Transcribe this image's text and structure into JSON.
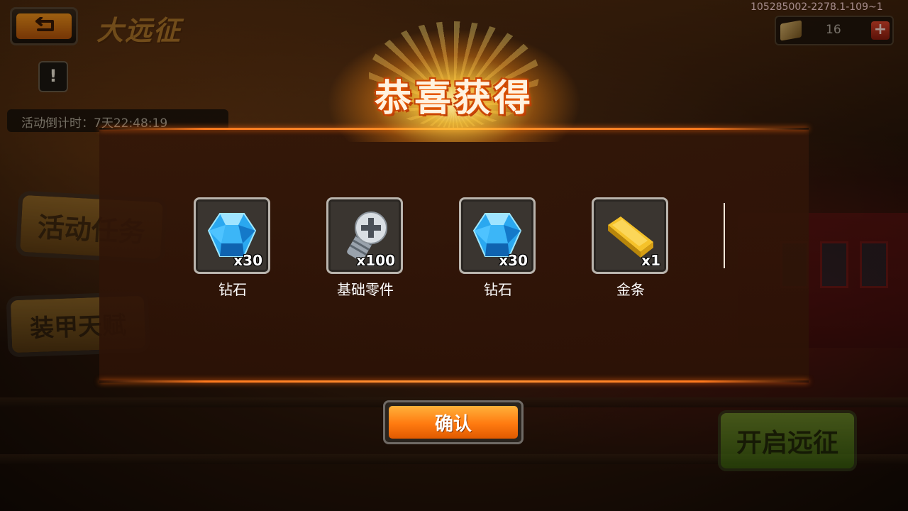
{
  "header": {
    "title": "大远征",
    "build_id": "105285002-2278.1-109~1",
    "currency_value": "16",
    "back_icon": "back-arrow-icon",
    "plus_icon": "plus-icon"
  },
  "event": {
    "alert_symbol": "!",
    "countdown": "活动倒计时：7天22:48:19"
  },
  "side_menu": {
    "event_tasks": "活动任务",
    "armor_talent": "装甲天赋"
  },
  "start_button": "开启远征",
  "modal": {
    "title": "恭喜获得",
    "confirm_label": "确认",
    "rewards": [
      {
        "name": "钻石",
        "qty": "x30",
        "icon": "diamond-icon"
      },
      {
        "name": "基础零件",
        "qty": "x100",
        "icon": "screw-icon"
      },
      {
        "name": "钻石",
        "qty": "x30",
        "icon": "diamond-icon"
      },
      {
        "name": "金条",
        "qty": "x1",
        "icon": "gold-bar-icon"
      }
    ]
  },
  "colors": {
    "accent_orange": "#ff7a1e",
    "title_glow": "#ff6a00",
    "confirm_button": "#ff8a1a",
    "start_button_green": "#6fb02a"
  }
}
